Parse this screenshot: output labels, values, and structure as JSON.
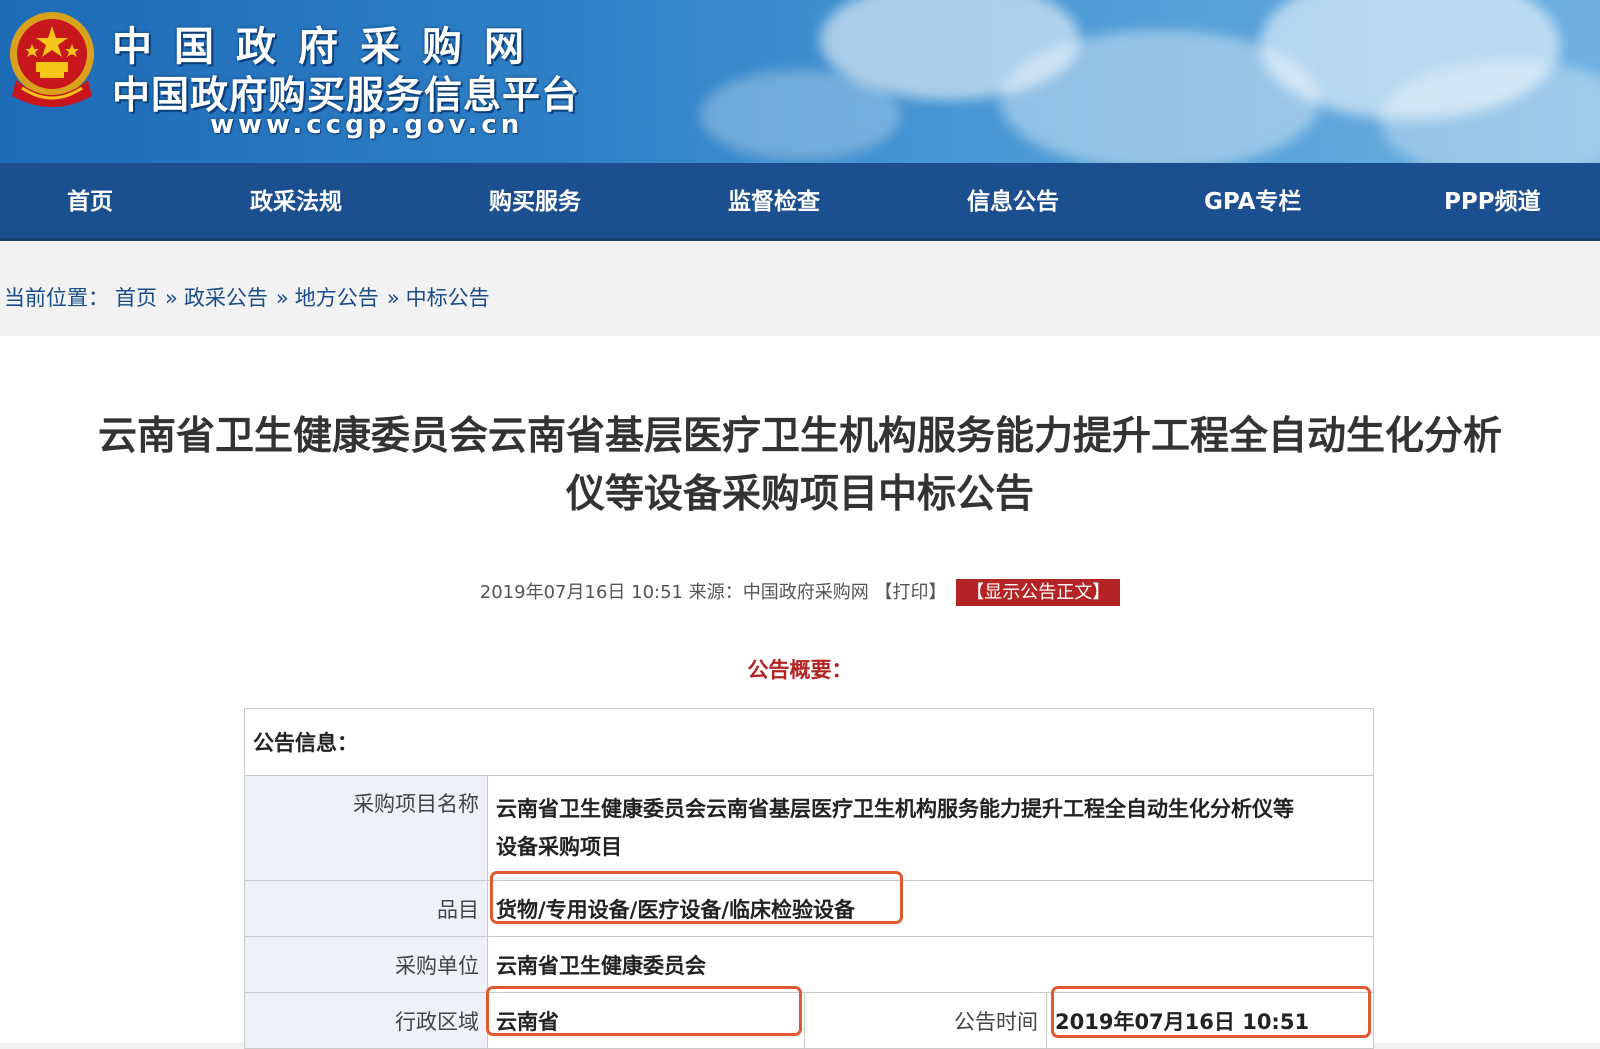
{
  "header": {
    "site_title": "中国政府采购网",
    "site_subtitle": "中国政府购买服务信息平台",
    "site_url": "www.ccgp.gov.cn"
  },
  "nav": {
    "items": [
      "首页",
      "政采法规",
      "购买服务",
      "监督检查",
      "信息公告",
      "GPA专栏",
      "PPP频道"
    ]
  },
  "breadcrumb": {
    "prefix": "当前位置：",
    "items": [
      "首页",
      "政采公告",
      "地方公告",
      "中标公告"
    ],
    "separator": "»"
  },
  "article": {
    "title_line1": "云南省卫生健康委员会云南省基层医疗卫生机构服务能力提升工程全自动生化分析",
    "title_line2": "仪等设备采购项目中标公告",
    "date": "2019年07月16日 10:51",
    "source_label": "来源：",
    "source": "中国政府采购网",
    "print": "【打印】",
    "show_full": "【显示公告正文】",
    "summary_heading": "公告概要："
  },
  "info_table": {
    "header": "公告信息：",
    "project_name_label": "采购项目名称",
    "project_name_line1": "云南省卫生健康委员会云南省基层医疗卫生机构服务能力提升工程全自动生化分析仪等",
    "project_name_line2": "设备采购项目",
    "category_label": "品目",
    "category": "货物/专用设备/医疗设备/临床检验设备",
    "purchaser_label": "采购单位",
    "purchaser": "云南省卫生健康委员会",
    "region_label": "行政区域",
    "region": "云南省",
    "publish_time_label": "公告时间",
    "publish_time": "2019年07月16日 10:51"
  },
  "colors": {
    "banner_blue": "#2f80c6",
    "nav_blue": "#1c4f8f",
    "accent_red": "#b52424",
    "highlight_orange": "#e0592c"
  }
}
